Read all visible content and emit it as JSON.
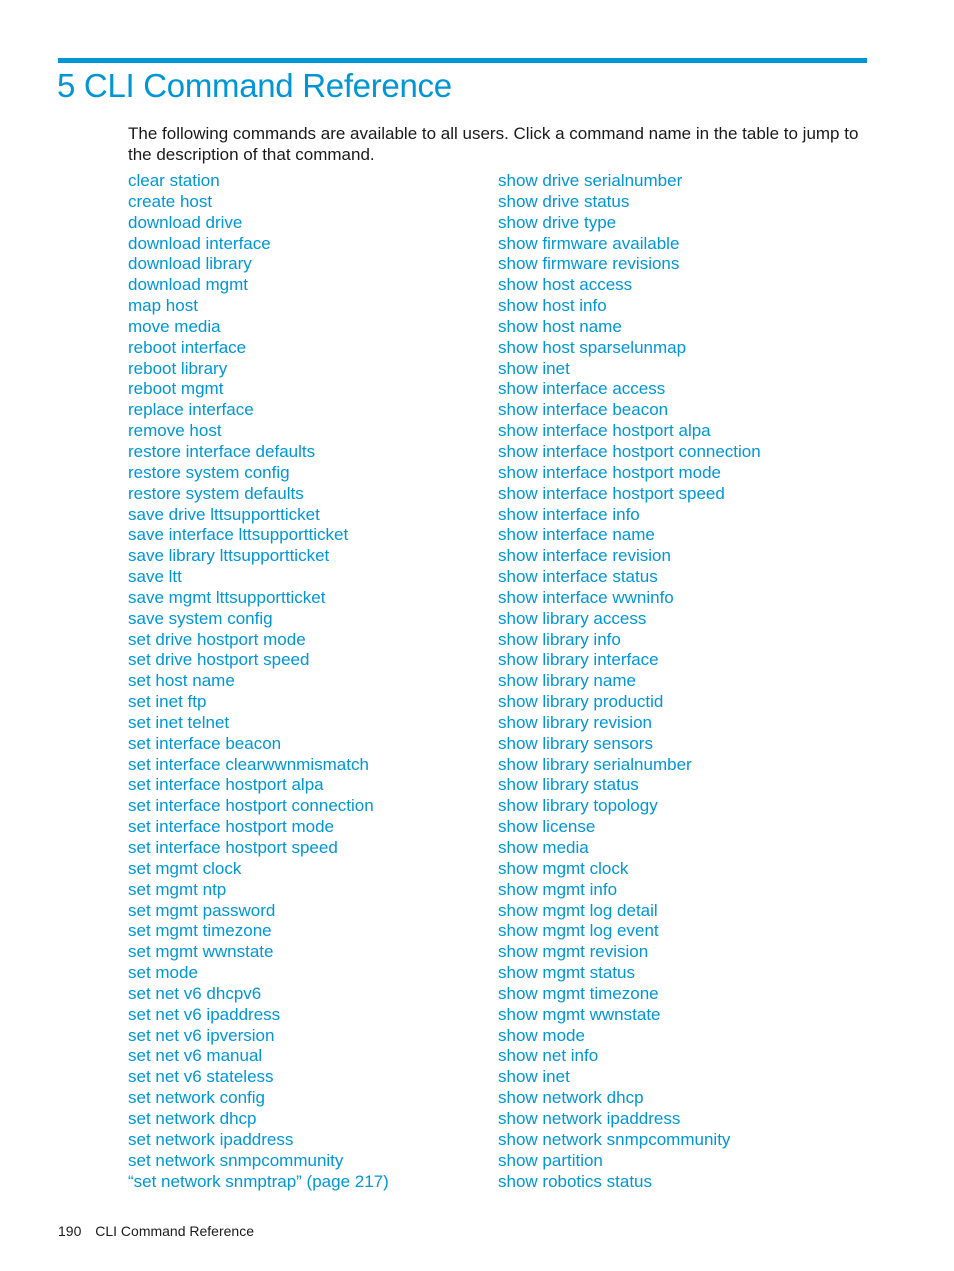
{
  "chapter": {
    "title": "5 CLI Command Reference"
  },
  "intro": "The following commands are available to all users. Click a command name in the table to jump to the description of that command.",
  "colors": {
    "accent": "#0096d6",
    "text": "#1a1a1a"
  },
  "commands": {
    "left": [
      "clear station",
      "create host",
      "download drive",
      "download interface",
      "download library",
      "download mgmt",
      "map host",
      "move media",
      "reboot interface",
      "reboot library",
      "reboot mgmt",
      "replace interface",
      "remove host",
      "restore interface defaults",
      "restore system config",
      "restore system defaults",
      "save drive lttsupportticket",
      "save interface lttsupportticket",
      "save library lttsupportticket",
      "save ltt",
      "save mgmt lttsupportticket",
      "save system config",
      "set drive hostport mode",
      "set drive hostport speed",
      "set host name",
      "set inet ftp",
      "set inet telnet",
      "set interface beacon",
      "set interface clearwwnmismatch",
      "set interface hostport alpa",
      "set interface hostport connection",
      "set interface hostport mode",
      "set interface hostport speed",
      "set mgmt clock",
      "set mgmt ntp",
      "set mgmt password",
      "set mgmt timezone",
      "set mgmt wwnstate",
      "set mode",
      "set net v6 dhcpv6",
      "set net v6 ipaddress",
      "set net v6 ipversion",
      "set net v6 manual",
      "set net v6 stateless",
      "set network config",
      "set network dhcp",
      "set network ipaddress",
      "set network snmpcommunity",
      "“set network snmptrap” (page 217)"
    ],
    "right": [
      "show drive serialnumber",
      "show drive status",
      "show drive type",
      "show firmware available",
      "show firmware revisions",
      "show host access",
      "show host info",
      "show host name",
      "show host sparselunmap",
      "show inet",
      "show interface access",
      "show interface beacon",
      "show interface hostport alpa",
      "show interface hostport connection",
      "show interface hostport mode",
      "show interface hostport speed",
      "show interface info",
      "show interface name",
      "show interface revision",
      "show interface status",
      "show interface wwninfo",
      "show library access",
      "show library info",
      "show library interface",
      "show library name",
      "show library productid",
      "show library revision",
      "show library sensors",
      "show library serialnumber",
      "show library status",
      "show library topology",
      "show license",
      "show media",
      "show mgmt clock",
      "show mgmt info",
      "show mgmt log detail",
      "show mgmt log event",
      "show mgmt revision",
      "show mgmt status",
      "show mgmt timezone",
      "show mgmt wwnstate",
      "show mode",
      "show net info",
      "show inet",
      "show network dhcp",
      "show network ipaddress",
      "show network snmpcommunity",
      "show partition",
      "show robotics status"
    ]
  },
  "footer": {
    "page_number": "190",
    "section": "CLI Command Reference"
  }
}
